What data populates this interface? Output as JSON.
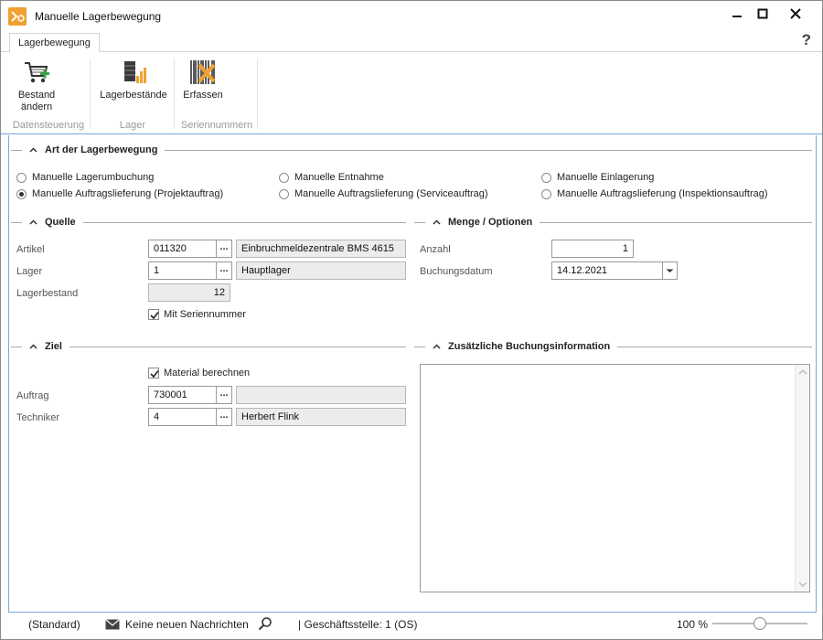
{
  "window": {
    "title": "Manuelle Lagerbewegung",
    "help": "?"
  },
  "ribbon": {
    "tab": "Lagerbewegung",
    "groups": [
      {
        "label": "Datensteuerung",
        "buttons": [
          {
            "label_line1": "Bestand",
            "label_line2": "ändern",
            "icon": "cart-add-icon"
          }
        ]
      },
      {
        "label": "Lager",
        "buttons": [
          {
            "label_line1": "Lagerbestände",
            "icon": "stock-levels-icon"
          }
        ]
      },
      {
        "label": "Seriennummern",
        "buttons": [
          {
            "label_line1": "Erfassen",
            "icon": "barcode-edit-icon"
          }
        ]
      }
    ]
  },
  "art": {
    "title": "Art der Lagerbewegung",
    "options": [
      {
        "label": "Manuelle Lagerumbuchung",
        "selected": false
      },
      {
        "label": "Manuelle Entnahme",
        "selected": false
      },
      {
        "label": "Manuelle Einlagerung",
        "selected": false
      },
      {
        "label": "Manuelle Auftragslieferung (Projektauftrag)",
        "selected": true
      },
      {
        "label": "Manuelle Auftragslieferung (Serviceauftrag)",
        "selected": false
      },
      {
        "label": "Manuelle Auftragslieferung (Inspektionsauftrag)",
        "selected": false
      }
    ]
  },
  "quelle": {
    "title": "Quelle",
    "artikel_label": "Artikel",
    "artikel_value": "011320",
    "artikel_name": "Einbruchmeldezentrale BMS 4615",
    "lager_label": "Lager",
    "lager_value": "1",
    "lager_name": "Hauptlager",
    "bestand_label": "Lagerbestand",
    "bestand_value": "12",
    "serial_label": "Mit Seriennummer",
    "serial_checked": true,
    "ellipsis": "..."
  },
  "menge": {
    "title": "Menge / Optionen",
    "anzahl_label": "Anzahl",
    "anzahl_value": "1",
    "datum_label": "Buchungsdatum",
    "datum_value": "14.12.2021"
  },
  "ziel": {
    "title": "Ziel",
    "material_label": "Material berechnen",
    "material_checked": true,
    "auftrag_label": "Auftrag",
    "auftrag_value": "730001",
    "auftrag_name": "",
    "techniker_label": "Techniker",
    "techniker_value": "4",
    "techniker_name": "Herbert Flink"
  },
  "info": {
    "title": "Zusätzliche Buchungsinformation",
    "text": ""
  },
  "status": {
    "profile": "(Standard)",
    "messages": "Keine neuen Nachrichten",
    "branch": "| Geschäftsstelle:  1 (OS)",
    "zoom": "100 %"
  }
}
